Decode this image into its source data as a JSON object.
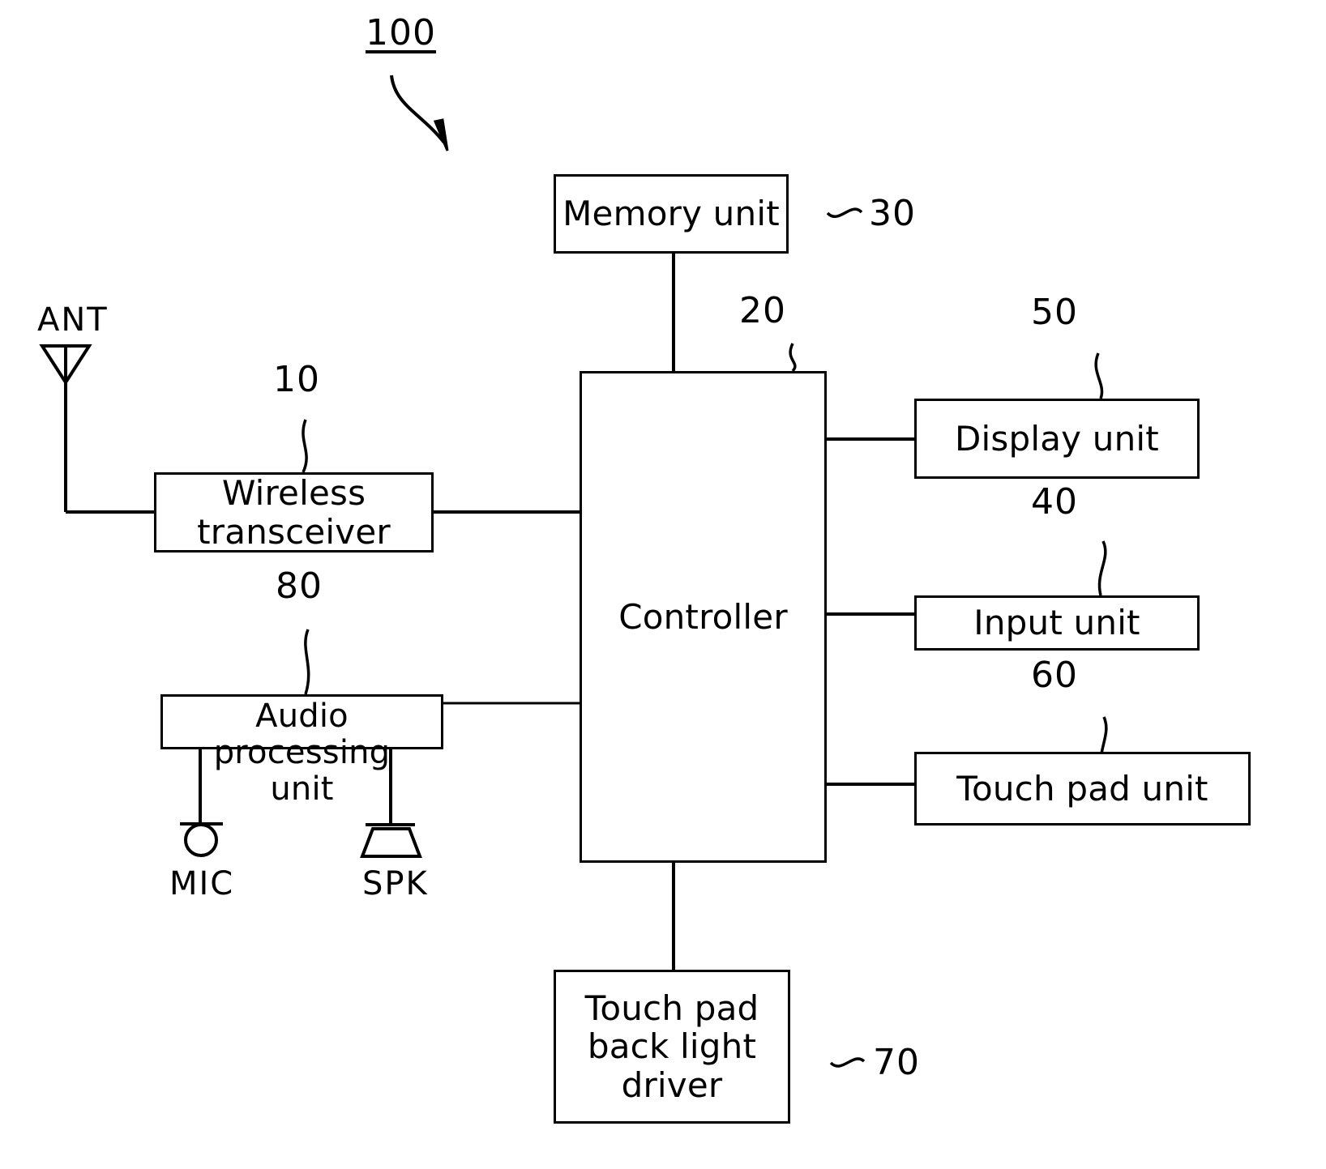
{
  "figure": {
    "overall_ref": "100",
    "blocks": [
      {
        "id": "memory",
        "label": "Memory unit",
        "ref": "30"
      },
      {
        "id": "controller",
        "label": "Controller",
        "ref": "20"
      },
      {
        "id": "wireless",
        "label": "Wireless\ntransceiver",
        "ref": "10"
      },
      {
        "id": "audio",
        "label": "Audio processing\nunit",
        "ref": "80"
      },
      {
        "id": "display",
        "label": "Display unit",
        "ref": "50"
      },
      {
        "id": "input",
        "label": "Input unit",
        "ref": "40"
      },
      {
        "id": "touchpad",
        "label": "Touch pad unit",
        "ref": "60"
      },
      {
        "id": "backlight",
        "label": "Touch pad\nback light\ndriver",
        "ref": "70"
      }
    ],
    "terminals": [
      {
        "id": "ant",
        "label": "ANT"
      },
      {
        "id": "mic",
        "label": "MIC"
      },
      {
        "id": "spk",
        "label": "SPK"
      }
    ]
  },
  "style": {
    "line_color": "#000000",
    "background": "#ffffff"
  }
}
